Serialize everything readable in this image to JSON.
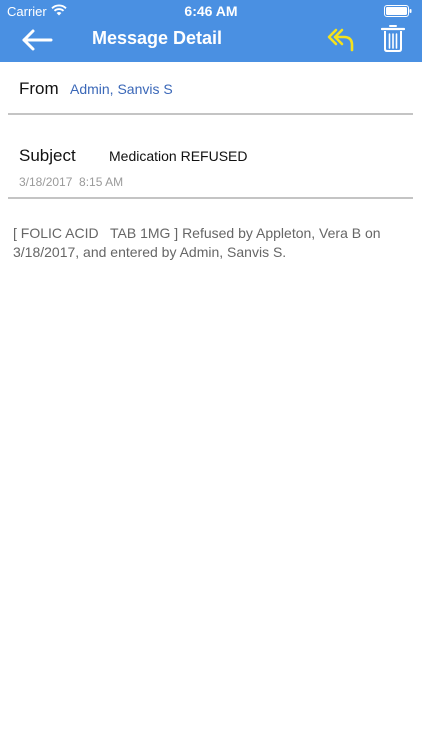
{
  "status_bar": {
    "carrier": "Carrier",
    "time": "6:46 AM"
  },
  "nav": {
    "title": "Message Detail",
    "back_icon": "back-arrow-icon",
    "reply_icon": "reply-icon",
    "delete_icon": "trash-icon"
  },
  "message": {
    "from_label": "From",
    "from_value": "Admin, Sanvis S",
    "subject_label": "Subject",
    "subject_value": "Medication REFUSED",
    "date_time": "3/18/2017  8:15 AM",
    "body": "[ FOLIC ACID   TAB 1MG ] Refused by Appleton, Vera B on 3/18/2017, and entered by Admin, Sanvis S."
  },
  "colors": {
    "header": "#4a90e2",
    "reply_icon": "#f5e11c",
    "from_value": "#3b68b8",
    "divider": "#c4c4c4"
  }
}
